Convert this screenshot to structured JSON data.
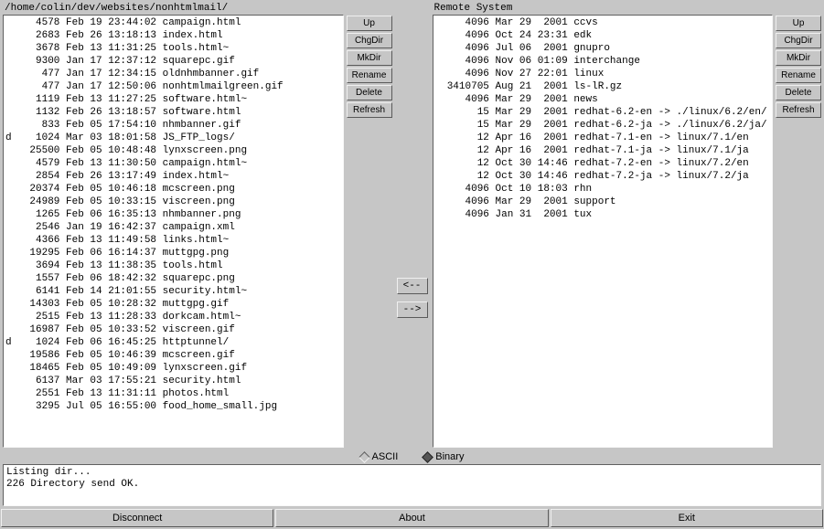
{
  "local_title": "/home/colin/dev/websites/nonhtmlmail/",
  "remote_title": "Remote System",
  "buttons": {
    "up": "Up",
    "chgdir": "ChgDir",
    "mkdir": "MkDir",
    "rename": "Rename",
    "delete": "Delete",
    "refresh": "Refresh"
  },
  "transfer": {
    "left": "<--",
    "right": "-->"
  },
  "mode": {
    "ascii": "ASCII",
    "binary": "Binary",
    "selected": "binary"
  },
  "log": "Listing dir...\n226 Directory send OK.",
  "bottom": {
    "disconnect": "Disconnect",
    "about": "About",
    "exit": "Exit"
  },
  "local_files": [
    {
      "flag": "",
      "size": 4578,
      "date": "Feb 19 23:44:02",
      "name": "campaign.html"
    },
    {
      "flag": "",
      "size": 2683,
      "date": "Feb 26 13:18:13",
      "name": "index.html"
    },
    {
      "flag": "",
      "size": 3678,
      "date": "Feb 13 11:31:25",
      "name": "tools.html~"
    },
    {
      "flag": "",
      "size": 9300,
      "date": "Jan 17 12:37:12",
      "name": "squarepc.gif"
    },
    {
      "flag": "",
      "size": 477,
      "date": "Jan 17 12:34:15",
      "name": "oldnhmbanner.gif"
    },
    {
      "flag": "",
      "size": 477,
      "date": "Jan 17 12:50:06",
      "name": "nonhtmlmailgreen.gif"
    },
    {
      "flag": "",
      "size": 1119,
      "date": "Feb 13 11:27:25",
      "name": "software.html~"
    },
    {
      "flag": "",
      "size": 1132,
      "date": "Feb 26 13:18:57",
      "name": "software.html"
    },
    {
      "flag": "",
      "size": 833,
      "date": "Feb 05 17:54:10",
      "name": "nhmbanner.gif"
    },
    {
      "flag": "d",
      "size": 1024,
      "date": "Mar 03 18:01:58",
      "name": "JS_FTP_logs/"
    },
    {
      "flag": "",
      "size": 25500,
      "date": "Feb 05 10:48:48",
      "name": "lynxscreen.png"
    },
    {
      "flag": "",
      "size": 4579,
      "date": "Feb 13 11:30:50",
      "name": "campaign.html~"
    },
    {
      "flag": "",
      "size": 2854,
      "date": "Feb 26 13:17:49",
      "name": "index.html~"
    },
    {
      "flag": "",
      "size": 20374,
      "date": "Feb 05 10:46:18",
      "name": "mcscreen.png"
    },
    {
      "flag": "",
      "size": 24989,
      "date": "Feb 05 10:33:15",
      "name": "viscreen.png"
    },
    {
      "flag": "",
      "size": 1265,
      "date": "Feb 06 16:35:13",
      "name": "nhmbanner.png"
    },
    {
      "flag": "",
      "size": 2546,
      "date": "Jan 19 16:42:37",
      "name": "campaign.xml"
    },
    {
      "flag": "",
      "size": 4366,
      "date": "Feb 13 11:49:58",
      "name": "links.html~"
    },
    {
      "flag": "",
      "size": 19295,
      "date": "Feb 06 16:14:37",
      "name": "muttgpg.png"
    },
    {
      "flag": "",
      "size": 3694,
      "date": "Feb 13 11:38:35",
      "name": "tools.html"
    },
    {
      "flag": "",
      "size": 1557,
      "date": "Feb 06 18:42:32",
      "name": "squarepc.png"
    },
    {
      "flag": "",
      "size": 6141,
      "date": "Feb 14 21:01:55",
      "name": "security.html~"
    },
    {
      "flag": "",
      "size": 14303,
      "date": "Feb 05 10:28:32",
      "name": "muttgpg.gif"
    },
    {
      "flag": "",
      "size": 2515,
      "date": "Feb 13 11:28:33",
      "name": "dorkcam.html~"
    },
    {
      "flag": "",
      "size": 16987,
      "date": "Feb 05 10:33:52",
      "name": "viscreen.gif"
    },
    {
      "flag": "d",
      "size": 1024,
      "date": "Feb 06 16:45:25",
      "name": "httptunnel/"
    },
    {
      "flag": "",
      "size": 19586,
      "date": "Feb 05 10:46:39",
      "name": "mcscreen.gif"
    },
    {
      "flag": "",
      "size": 18465,
      "date": "Feb 05 10:49:09",
      "name": "lynxscreen.gif"
    },
    {
      "flag": "",
      "size": 6137,
      "date": "Mar 03 17:55:21",
      "name": "security.html"
    },
    {
      "flag": "",
      "size": 2551,
      "date": "Feb 13 11:31:11",
      "name": "photos.html"
    },
    {
      "flag": "",
      "size": 3295,
      "date": "Jul 05 16:55:00",
      "name": "food_home_small.jpg"
    }
  ],
  "remote_files": [
    {
      "size": 4096,
      "date": "Mar 29  2001",
      "name": "ccvs"
    },
    {
      "size": 4096,
      "date": "Oct 24 23:31",
      "name": "edk"
    },
    {
      "size": 4096,
      "date": "Jul 06  2001",
      "name": "gnupro"
    },
    {
      "size": 4096,
      "date": "Nov 06 01:09",
      "name": "interchange"
    },
    {
      "size": 4096,
      "date": "Nov 27 22:01",
      "name": "linux"
    },
    {
      "size": 3410705,
      "date": "Aug 21  2001",
      "name": "ls-lR.gz"
    },
    {
      "size": 4096,
      "date": "Mar 29  2001",
      "name": "news"
    },
    {
      "size": 15,
      "date": "Mar 29  2001",
      "name": "redhat-6.2-en -> ./linux/6.2/en/"
    },
    {
      "size": 15,
      "date": "Mar 29  2001",
      "name": "redhat-6.2-ja -> ./linux/6.2/ja/"
    },
    {
      "size": 12,
      "date": "Apr 16  2001",
      "name": "redhat-7.1-en -> linux/7.1/en"
    },
    {
      "size": 12,
      "date": "Apr 16  2001",
      "name": "redhat-7.1-ja -> linux/7.1/ja"
    },
    {
      "size": 12,
      "date": "Oct 30 14:46",
      "name": "redhat-7.2-en -> linux/7.2/en"
    },
    {
      "size": 12,
      "date": "Oct 30 14:46",
      "name": "redhat-7.2-ja -> linux/7.2/ja"
    },
    {
      "size": 4096,
      "date": "Oct 10 18:03",
      "name": "rhn"
    },
    {
      "size": 4096,
      "date": "Mar 29  2001",
      "name": "support"
    },
    {
      "size": 4096,
      "date": "Jan 31  2001",
      "name": "tux"
    }
  ]
}
